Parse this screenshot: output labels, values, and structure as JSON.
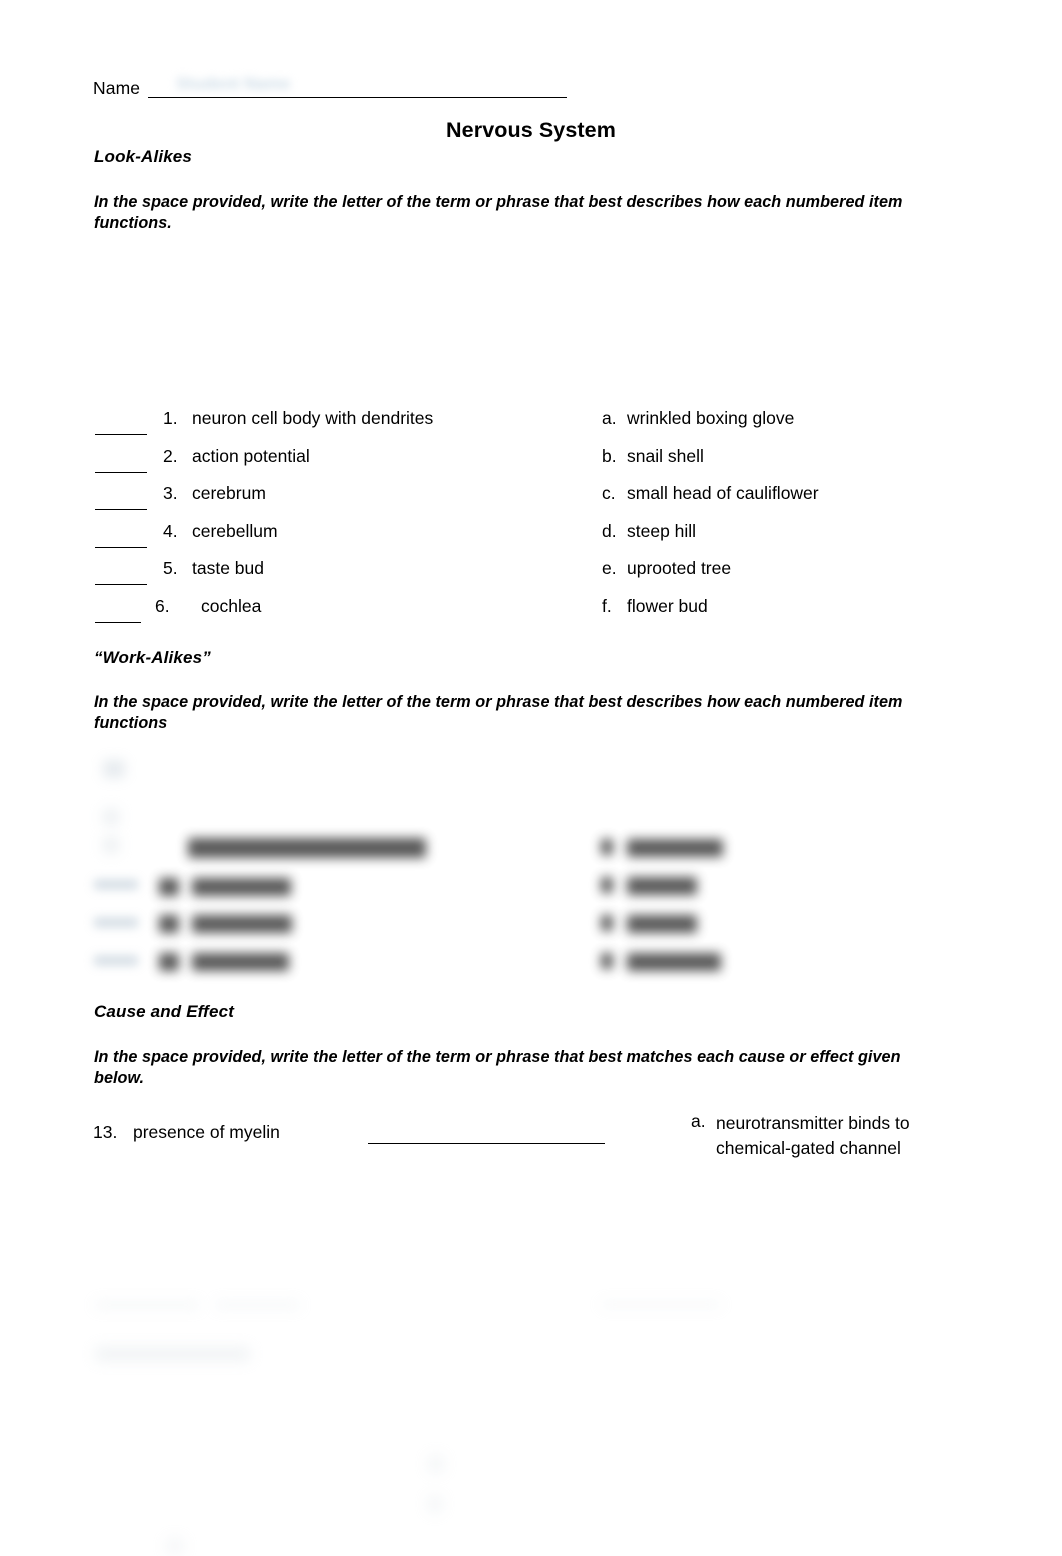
{
  "document": {
    "title": "Nervous System",
    "name_label": "Name",
    "name_value": "Student Name"
  },
  "look_alikes": {
    "heading": "Look-Alikes",
    "instructions": "In the space provided, write the letter of the term or phrase that best describes how each numbered item functions.",
    "items": [
      {
        "number": "1.",
        "text": "neuron cell body with dendrites",
        "answer": ""
      },
      {
        "number": "2.",
        "text": "action potential",
        "answer": ""
      },
      {
        "number": "3.",
        "text": "cerebrum",
        "answer": ""
      },
      {
        "number": "4.",
        "text": "cerebellum",
        "answer": ""
      },
      {
        "number": "5.",
        "text": "taste bud",
        "answer": ""
      },
      {
        "number": "6.",
        "text": "cochlea",
        "answer": ""
      }
    ],
    "options": [
      {
        "letter": "a.",
        "text": "wrinkled boxing glove"
      },
      {
        "letter": "b.",
        "text": "snail shell"
      },
      {
        "letter": "c.",
        "text": "small head of cauliflower"
      },
      {
        "letter": "d.",
        "text": "steep hill"
      },
      {
        "letter": "e.",
        "text": "uprooted tree"
      },
      {
        "letter": "f.",
        "text": "flower bud"
      }
    ]
  },
  "work_alikes": {
    "heading": "“Work-Alikes”",
    "instructions": "In the space provided, write the letter of the term or phrase that best describes how each numbered item functions",
    "content_state": "obscured"
  },
  "cause_and_effect": {
    "heading": "Cause and Effect",
    "instructions": "In the space provided, write the letter of the term or phrase that best matches each cause or effect given below.",
    "item": {
      "number": "13.",
      "text": "presence of myelin",
      "answer": ""
    },
    "option": {
      "letter": "a.",
      "text": "neurotransmitter binds to chemical-gated channel"
    }
  }
}
